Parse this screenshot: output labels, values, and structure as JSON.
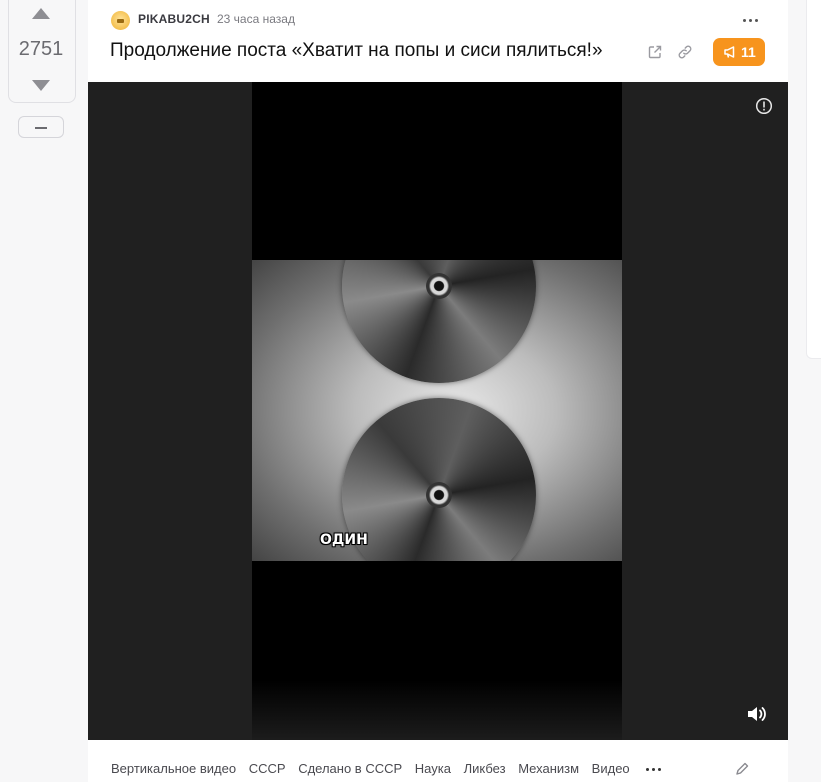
{
  "rating": {
    "value": "2751"
  },
  "post": {
    "author": "PIKABU2CH",
    "time": "23 часа назад",
    "title": "Продолжение поста «Хватит на попы и сиси пялиться!»",
    "comments_count": "11",
    "accent_color": "#f7941d"
  },
  "video": {
    "caption": "ОДИН"
  },
  "tags": [
    "Вертикальное видео",
    "СССР",
    "Сделано в СССР",
    "Наука",
    "Ликбез",
    "Механизм",
    "Видео"
  ],
  "icons": {
    "vote_up": "triangle-up-icon",
    "vote_down": "triangle-down-icon",
    "collapse": "minus-icon",
    "more": "more-dots-icon",
    "external_link": "external-link-icon",
    "copy_link": "link-icon",
    "comments": "megaphone-icon",
    "report": "exclamation-circle-icon",
    "volume": "speaker-icon",
    "edit": "pencil-icon"
  }
}
